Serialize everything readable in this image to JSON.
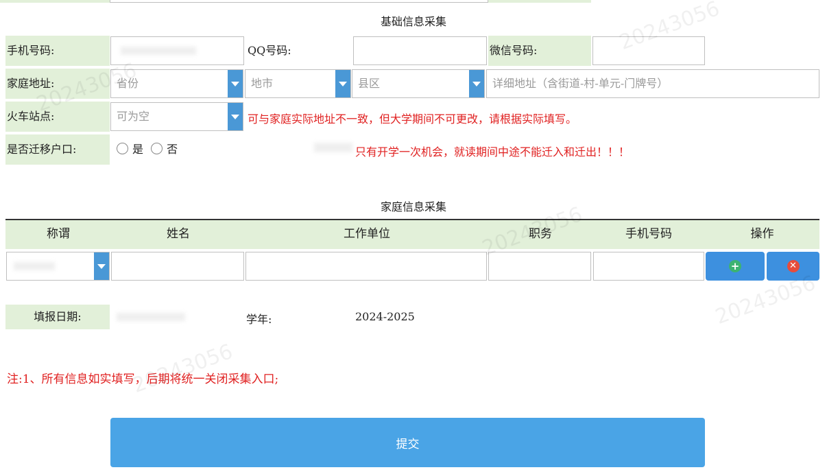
{
  "basic": {
    "title": "基础信息采集",
    "phone_label": "手机号码:",
    "qq_label": "QQ号码:",
    "wechat_label": "微信号码:",
    "address_label": "家庭地址:",
    "province_placeholder": "省份",
    "city_placeholder": "地市",
    "county_placeholder": "县区",
    "detail_placeholder": "详细地址（含街道-村-单元-门牌号）",
    "station_label": "火车站点:",
    "station_placeholder": "可为空",
    "station_note": "可与家庭实际地址不一致，但大学期间不可更改，请根据实际填写。",
    "hukou_label": "是否迁移户口:",
    "hukou_yes": "是",
    "hukou_no": "否",
    "hukou_note": "只有开学一次机会，就读期间中途不能迁入和迁出！！！"
  },
  "family": {
    "title": "家庭信息采集",
    "headers": [
      "称谓",
      "姓名",
      "工作单位",
      "职务",
      "手机号码",
      "操作"
    ]
  },
  "footer": {
    "date_label": "填报日期:",
    "year_label": "学年:",
    "year_value": "2024-2025",
    "note": "注:1、所有信息如实填写，后期将统一关闭采集入口;",
    "submit_label": "提交"
  },
  "watermark": {
    "text": "20243056"
  },
  "colors": {
    "label_bg": "#e2f0d9",
    "dropdown_accent": "#4a98d6",
    "warning_text": "#e02020",
    "add_icon": "#3cb371",
    "remove_icon": "#e74c3c",
    "submit_bg": "#4aa4e6"
  },
  "icons": {
    "dropdown": "chevron-down-icon",
    "add": "plus-circle-icon",
    "remove": "x-circle-icon"
  }
}
